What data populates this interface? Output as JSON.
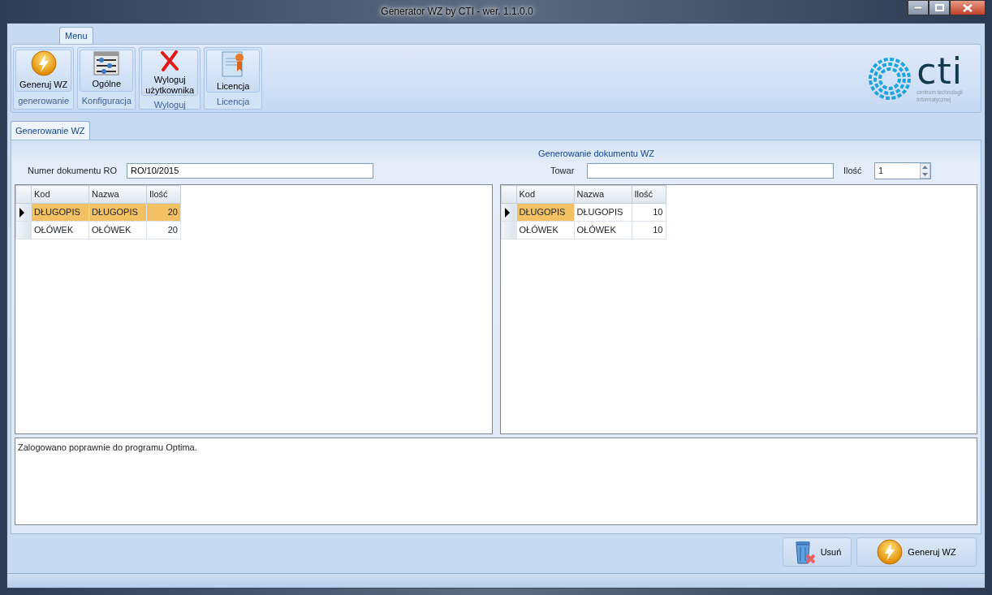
{
  "window": {
    "title": "Generator WZ by CTI -  wer. 1.1.0.0"
  },
  "ribbon": {
    "tabs": [
      {
        "label": "Menu",
        "selected": true
      }
    ],
    "groups": [
      {
        "label": "generowanie",
        "buttons": [
          {
            "label": "Generuj WZ",
            "kind": "bolt"
          }
        ]
      },
      {
        "label": "Konfiguracja",
        "buttons": [
          {
            "label": "Ogólne",
            "kind": "sliders"
          }
        ]
      },
      {
        "label": "Wyloguj",
        "buttons": [
          {
            "label": "Wyloguj\nużytkownika",
            "kind": "cross"
          }
        ]
      },
      {
        "label": "Licencja",
        "buttons": [
          {
            "label": "Licencja",
            "kind": "certificate"
          }
        ]
      }
    ],
    "logo": {
      "text": "cti",
      "subtitle": "centrum technologii\ninformatycznej"
    }
  },
  "document_tabs": [
    {
      "label": "Generowanie WZ",
      "selected": true
    }
  ],
  "form": {
    "ro_label": "Numer dokumentu RO",
    "ro_value": "RO/10/2015",
    "section_title": "Generowanie dokumentu WZ",
    "towar_label": "Towar",
    "ilosc_label": "Ilość",
    "ilosc_value": "1"
  },
  "grids": [
    {
      "columns": [
        "Kod",
        "Nazwa",
        "Ilość"
      ],
      "rows": [
        {
          "current": true,
          "cells": [
            {
              "text": "DŁUGOPIS",
              "selected": true
            },
            {
              "text": "DŁUGOPIS",
              "selected": true
            },
            {
              "text": "20",
              "selected": true
            }
          ]
        },
        {
          "current": false,
          "cells": [
            {
              "text": "OŁÓWEK",
              "selected": false
            },
            {
              "text": "OŁÓWEK",
              "selected": false
            },
            {
              "text": "20",
              "selected": false
            }
          ]
        }
      ]
    },
    {
      "columns": [
        "Kod",
        "Nazwa",
        "Ilość"
      ],
      "rows": [
        {
          "current": true,
          "cells": [
            {
              "text": "DŁUGOPIS",
              "selected": true
            },
            {
              "text": "DŁUGOPIS",
              "selected": false
            },
            {
              "text": "10",
              "selected": false
            }
          ]
        },
        {
          "current": false,
          "cells": [
            {
              "text": "OŁÓWEK",
              "selected": false
            },
            {
              "text": "OŁÓWEK",
              "selected": false
            },
            {
              "text": "10",
              "selected": false
            }
          ]
        }
      ]
    }
  ],
  "log": "Zalogowano poprawnie do programu Optima.",
  "buttons": [
    {
      "label": "Usuń",
      "kind": "trash"
    },
    {
      "label": "Generuj WZ",
      "kind": "bolt"
    }
  ]
}
